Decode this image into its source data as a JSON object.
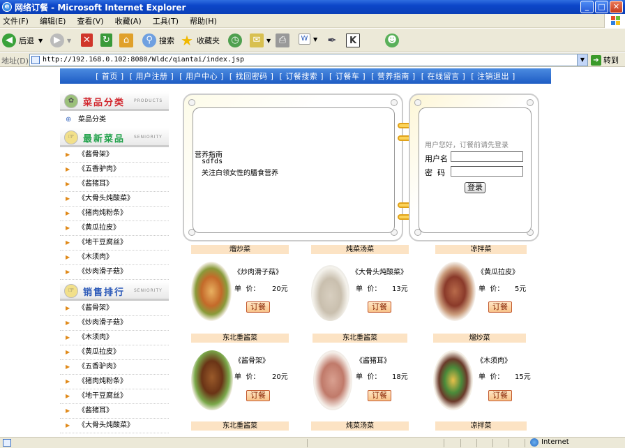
{
  "window": {
    "title": "网络订餐 - Microsoft Internet Explorer"
  },
  "menu": [
    "文件(F)",
    "编辑(E)",
    "查看(V)",
    "收藏(A)",
    "工具(T)",
    "帮助(H)"
  ],
  "toolbar": {
    "back": "后退",
    "search": "搜索",
    "favorites": "收藏夹"
  },
  "address": {
    "label": "地址(D)",
    "url": "http://192.168.0.102:8080/Wldc/qiantai/index.jsp",
    "go": "转到"
  },
  "nav": [
    "[ 首页 ]",
    "[ 用户注册 ]",
    "[ 用户中心 ]",
    "[ 找回密码 ]",
    "[ 订餐搜索 ]",
    "[ 订餐车 ]",
    "[ 营养指南 ]",
    "[ 在线留言 ]",
    "[ 注销退出 ]"
  ],
  "sidebar": {
    "categories": {
      "title": "菜品分类",
      "en": "PRODUCTS",
      "items": [
        "菜品分类"
      ]
    },
    "newest": {
      "title": "最新菜品",
      "en": "SENIORITY",
      "items": [
        "《酱骨架》",
        "《五香驴肉》",
        "《酱猪耳》",
        "《大骨头炖酸菜》",
        "《猪肉炖粉条》",
        "《黄瓜拉皮》",
        "《地干豆腐丝》",
        "《木须肉》",
        "《炒肉滑子菇》"
      ]
    },
    "ranking": {
      "title": "销售排行",
      "en": "SENIORITY",
      "items": [
        "《酱骨架》",
        "《炒肉滑子菇》",
        "《木须肉》",
        "《黄瓜拉皮》",
        "《五香驴肉》",
        "《猪肉炖粉条》",
        "《地干豆腐丝》",
        "《酱猪耳》",
        "《大骨头炖酸菜》"
      ]
    }
  },
  "guide": {
    "title": "营养指南",
    "line1": "sdfds",
    "line2": "关注白领女性的膳食营养"
  },
  "login": {
    "prompt": "用户您好，订餐前请先登录",
    "username_label": "用户名",
    "password_label": "密  码",
    "button": "登录"
  },
  "products": [
    {
      "category": "熘炒菜",
      "name": "《炒肉滑子菇》",
      "price_label": "单  价：",
      "price": "20元",
      "order": "订餐"
    },
    {
      "category": "炖菜汤菜",
      "name": "《大骨头炖酸菜》",
      "price_label": "单  价：",
      "price": "13元",
      "order": "订餐"
    },
    {
      "category": "凉拌菜",
      "name": "《黄瓜拉皮》",
      "price_label": "单  价：",
      "price": "5元",
      "order": "订餐"
    },
    {
      "category": "东北重酱菜",
      "name": "《酱骨架》",
      "price_label": "单  价：",
      "price": "20元",
      "order": "订餐"
    },
    {
      "category": "东北重酱菜",
      "name": "《酱猪耳》",
      "price_label": "单  价：",
      "price": "18元",
      "order": "订餐"
    },
    {
      "category": "熘炒菜",
      "name": "《木须肉》",
      "price_label": "单  价：",
      "price": "15元",
      "order": "订餐"
    }
  ],
  "next_row_categories": [
    "东北重酱菜",
    "炖菜汤菜",
    "凉拌菜"
  ],
  "status": {
    "zone": "Internet"
  }
}
